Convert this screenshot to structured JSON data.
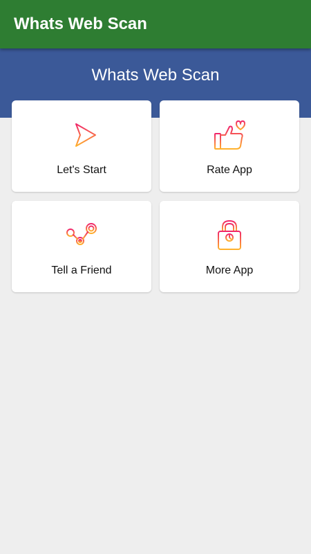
{
  "app_bar": {
    "title": "Whats Web Scan"
  },
  "header": {
    "title": "Whats Web Scan"
  },
  "menu": [
    {
      "label": "Let's Start",
      "icon": "play-arrow-icon"
    },
    {
      "label": "Rate App",
      "icon": "thumbs-up-heart-icon"
    },
    {
      "label": "Tell a Friend",
      "icon": "share-nodes-icon"
    },
    {
      "label": "More App",
      "icon": "lock-bag-icon"
    }
  ],
  "colors": {
    "app_bar": "#2e7d32",
    "header": "#3b5998",
    "background": "#eeeeee",
    "icon_gradient_start": "#f0246b",
    "icon_gradient_end": "#ffb22b"
  }
}
